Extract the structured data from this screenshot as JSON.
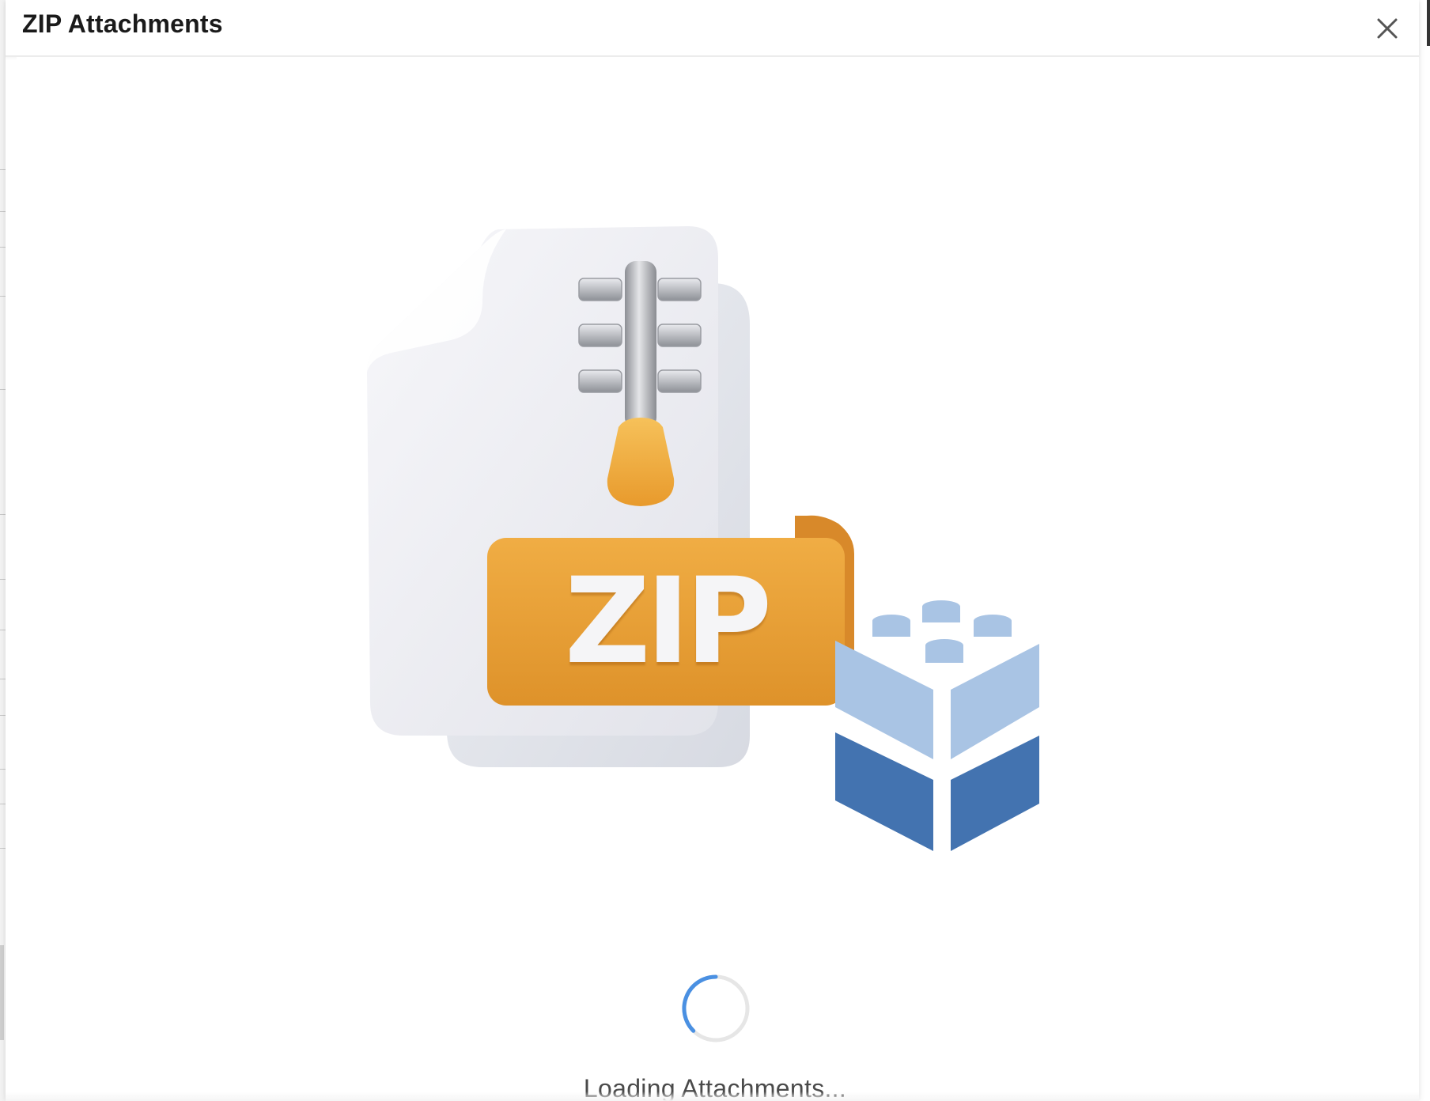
{
  "dialog": {
    "title": "ZIP Attachments",
    "close_icon": "close-icon"
  },
  "illustration": {
    "icon": "zip-file-icon",
    "badge_text": "ZIP",
    "secondary_icon": "building-block-icon",
    "colors": {
      "badge": "#e8a53a",
      "zipper_pull": "#f2b03c",
      "block_light": "#a9c4e4",
      "block_dark": "#4373b0"
    }
  },
  "status": {
    "spinner_icon": "loading-spinner-icon",
    "message": "Loading Attachments..."
  },
  "colors": {
    "spinner_accent": "#4a90e2",
    "spinner_track": "#e6e6e6"
  }
}
